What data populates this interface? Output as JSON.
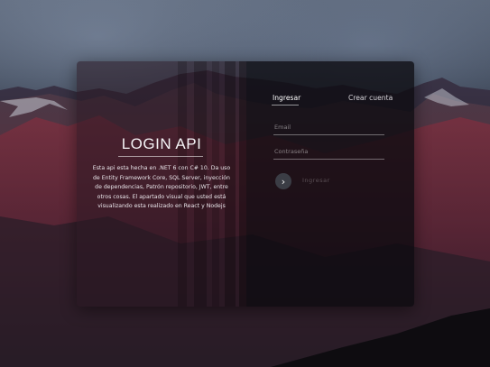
{
  "left_panel": {
    "title": "LOGIN API",
    "description": "Esta api esta hecha en .NET 6 con C# 10. Da uso de Entity Framework Core, SQL Server, inyección de dependencias, Patrón repositorio, JWT, entre otros cosas. El apartado visual que usted está visualizando esta realizado en React y Nodejs"
  },
  "tabs": [
    {
      "label": "Ingresar",
      "active": true
    },
    {
      "label": "Crear cuenta",
      "active": false
    }
  ],
  "form": {
    "email_placeholder": "Email",
    "password_placeholder": "Contraseña",
    "submit_icon": "chevron-right-icon",
    "submit_label": "Ingresar"
  },
  "colors": {
    "card_left": "#281620",
    "card_right": "#0c0a10",
    "button": "#3b3d45"
  }
}
